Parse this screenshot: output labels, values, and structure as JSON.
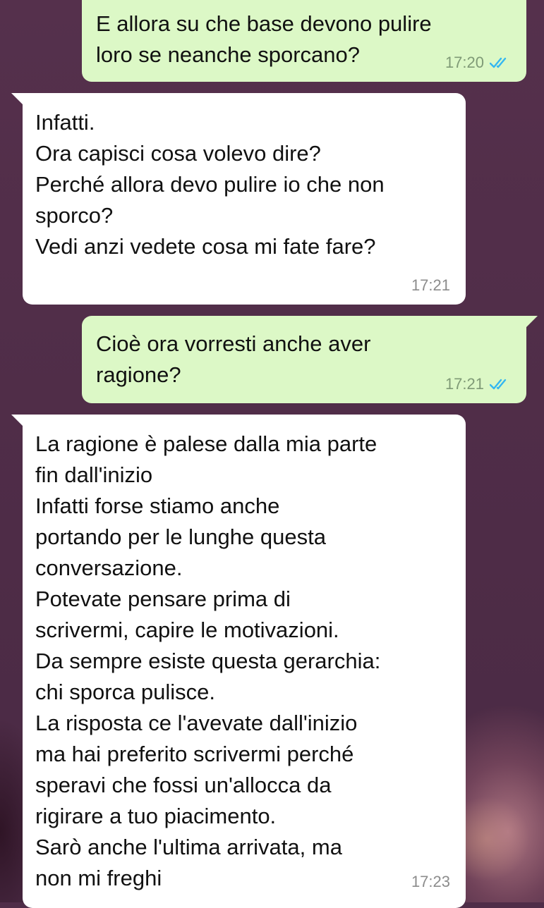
{
  "colors": {
    "background": "#4f2d48",
    "outgoing_bubble": "#dcf8c6",
    "incoming_bubble": "#ffffff",
    "read_ticks": "#34b7f1"
  },
  "messages": [
    {
      "direction": "outgoing",
      "text": "E allora su che base devono pulire\nloro se neanche sporcano?",
      "time": "17:20",
      "status": "read-double-check-icon"
    },
    {
      "direction": "incoming",
      "text": "Infatti.\nOra capisci cosa volevo dire?\nPerché allora devo pulire io che non\nsporco?\nVedi anzi vedete cosa mi fate fare?",
      "time": "17:21"
    },
    {
      "direction": "outgoing",
      "text": "Cioè ora vorresti anche aver\nragione?",
      "time": "17:21",
      "status": "read-double-check-icon"
    },
    {
      "direction": "incoming",
      "text": "La ragione è palese dalla mia parte\nfin dall'inizio\nInfatti forse stiamo anche\nportando per le lunghe questa\nconversazione.\nPotevate pensare prima di\nscrivermi, capire le motivazioni.\nDa sempre esiste questa gerarchia:\nchi sporca pulisce.\nLa risposta ce l'avevate dall'inizio\nma hai preferito scrivermi perché\nsperavi che fossi un'allocca da\nrigirare a tuo piacimento.\nSarò anche l'ultima arrivata, ma\nnon mi freghi",
      "time": "17:23"
    }
  ]
}
